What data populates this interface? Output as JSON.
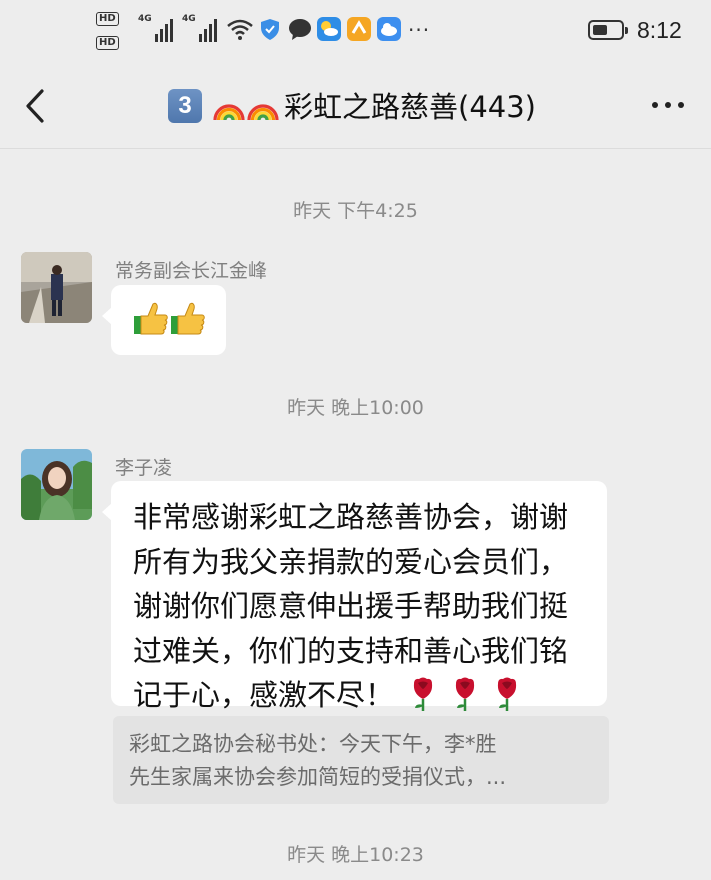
{
  "status_bar": {
    "hd_label_1": "HD",
    "hd_label_2": "HD",
    "network_1": "4G",
    "network_2": "4G",
    "more": "···",
    "time": "8:12",
    "battery_level": 0.55
  },
  "header": {
    "unread_count": "3",
    "title": "彩虹之路慈善(443)"
  },
  "messages": [
    {
      "type": "timestamp",
      "text": "昨天 下午4:25"
    },
    {
      "type": "message",
      "sender": "常务副会长江金峰",
      "content": "👍👍"
    },
    {
      "type": "timestamp",
      "text": "昨天 晚上10:00"
    },
    {
      "type": "message",
      "sender": "李子凌",
      "lines": [
        "非常感谢彩虹之路慈善协会，谢谢",
        "所有为我父亲捐款的爱心会员们，",
        "谢谢你们愿意伸出援手帮助我们挺",
        "过难关，你们的支持和善心我们铭",
        "记于心，感激不尽！"
      ],
      "quote": [
        "彩虹之路协会秘书处：今天下午，李*胜",
        "先生家属来协会参加简短的受捐仪式，..."
      ]
    },
    {
      "type": "timestamp",
      "text": "昨天 晚上10:23"
    }
  ],
  "colors": {
    "background": "#ededed",
    "bubble": "#ffffff",
    "quote_bg": "#e3e3e3",
    "timestamp": "#8a8a8a"
  }
}
